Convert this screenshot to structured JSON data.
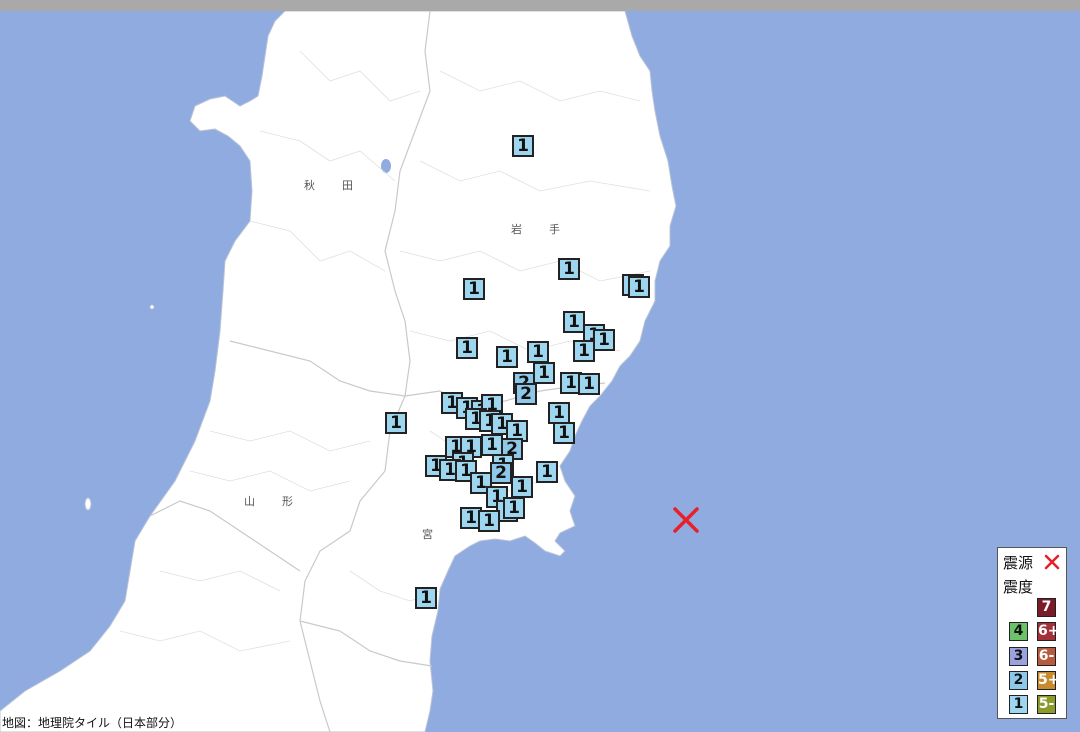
{
  "prefecture_labels": [
    {
      "chars": [
        "秋",
        "田"
      ]
    },
    {
      "chars": [
        "岩",
        "手"
      ]
    },
    {
      "chars": [
        "山",
        "形"
      ]
    },
    {
      "chars": [
        "宮"
      ]
    }
  ],
  "markers": [
    {
      "intensity": "1"
    },
    {
      "intensity": "1"
    },
    {
      "intensity": "1"
    },
    {
      "intensity": "1"
    },
    {
      "intensity": "1"
    },
    {
      "intensity": "1"
    },
    {
      "intensity": "1"
    },
    {
      "intensity": "1"
    },
    {
      "intensity": "1"
    },
    {
      "intensity": "1"
    },
    {
      "intensity": "1"
    },
    {
      "intensity": "1"
    },
    {
      "intensity": "2"
    },
    {
      "intensity": "1"
    },
    {
      "intensity": "2"
    },
    {
      "intensity": "1"
    },
    {
      "intensity": "1"
    },
    {
      "intensity": "1"
    },
    {
      "intensity": "1"
    },
    {
      "intensity": "1"
    },
    {
      "intensity": "1"
    },
    {
      "intensity": "1"
    },
    {
      "intensity": "1"
    },
    {
      "intensity": "1"
    },
    {
      "intensity": "1"
    },
    {
      "intensity": "1"
    },
    {
      "intensity": "1"
    },
    {
      "intensity": "1"
    },
    {
      "intensity": "1"
    },
    {
      "intensity": "1"
    },
    {
      "intensity": "1"
    },
    {
      "intensity": "2"
    },
    {
      "intensity": "1"
    },
    {
      "intensity": "1"
    },
    {
      "intensity": "2"
    },
    {
      "intensity": "1"
    },
    {
      "intensity": "1"
    },
    {
      "intensity": "1"
    },
    {
      "intensity": "1"
    },
    {
      "intensity": "1"
    },
    {
      "intensity": "1"
    },
    {
      "intensity": "1"
    },
    {
      "intensity": "1"
    }
  ],
  "epicenter": {
    "color": "#e8202a"
  },
  "legend": {
    "epicenter_label": "震源",
    "intensity_label": "震度",
    "scale": [
      {
        "label": "7",
        "color": "#7a1c28"
      },
      {
        "label": "6+",
        "color": "#a2303a"
      },
      {
        "label": "6-",
        "color": "#b85a3e"
      },
      {
        "label": "5+",
        "color": "#c98a2e"
      },
      {
        "label": "5-",
        "color": "#8c9a2a"
      },
      {
        "label": "4",
        "color": "#6cc16a"
      },
      {
        "label": "3",
        "color": "#9aa3e0"
      },
      {
        "label": "2",
        "color": "#8fc7e8"
      },
      {
        "label": "1",
        "color": "#9fd6ef"
      }
    ]
  },
  "attribution": "地図：地理院タイル（日本部分）",
  "colors": {
    "sea": "#90abdf",
    "land": "#ffffff",
    "border": "#cccccc",
    "lake": "#90abdf"
  }
}
